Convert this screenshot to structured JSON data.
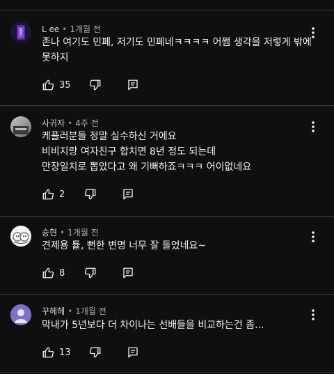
{
  "comments": [
    {
      "author": "L ee",
      "time": "1개월 전",
      "lines": [
        "존나 여기도 민폐, 저기도 민폐네ㅋㅋㅋㅋ 어쩜 생각을 저렇게 밖에",
        "못하지"
      ],
      "likes": "35",
      "avatar": "purple-figure"
    },
    {
      "author": "사귀자",
      "time": "4주 전",
      "lines": [
        "케플러분들 정말 실수하신 거에요",
        "비비지랑 여자친구 합치면 8년 정도 되는데",
        "만장일치로 뽑았다고 왜 기뻐하죠ㅋㅋㅋ 어이없네요"
      ],
      "likes": "2",
      "avatar": "photo"
    },
    {
      "author": "승현",
      "time": "1개월 전",
      "lines": [
        "견제용 튵, 뻔한 변명 너무 잘 들었네요~"
      ],
      "likes": "8",
      "avatar": "cartoon"
    },
    {
      "author": "꾸헤헤",
      "time": "1개월 전",
      "lines": [
        "막내가 5년보다 더 차이나는 선배들을 비교하는건 좀..."
      ],
      "likes": "13",
      "avatar": "default-person"
    }
  ],
  "icons": {
    "like": "thumb-up-icon",
    "dislike": "thumb-down-icon",
    "reply": "reply-icon",
    "more": "more-vert-icon"
  }
}
